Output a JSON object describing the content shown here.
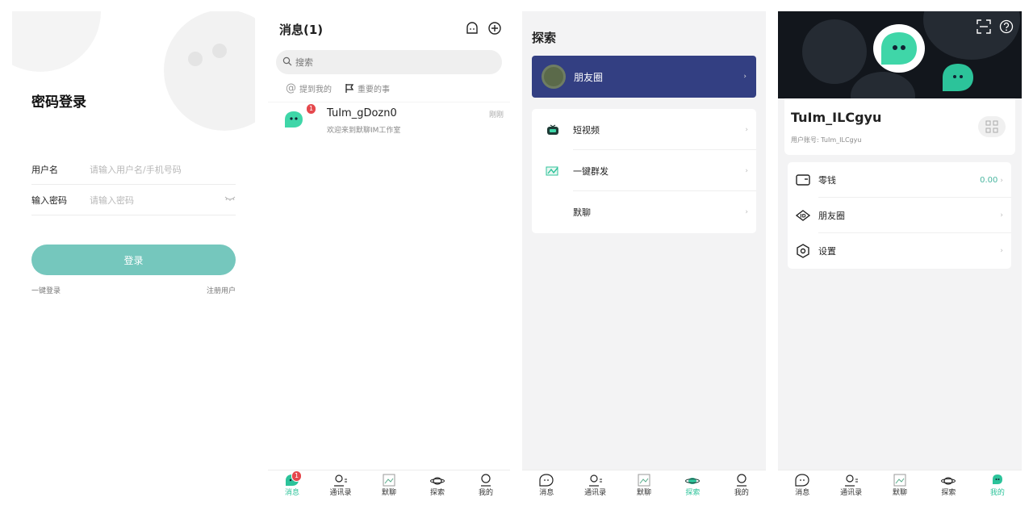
{
  "login": {
    "title": "密码登录",
    "username_label": "用户名",
    "username_placeholder": "请输入用户名/手机号码",
    "password_label": "输入密码",
    "password_placeholder": "请输入密码",
    "login_button": "登录",
    "quick_login": "一键登录",
    "register": "注册用户"
  },
  "messages": {
    "title": "消息(1)",
    "search_placeholder": "搜索",
    "filter_mentions": "提到我的",
    "filter_important": "重要的事",
    "conversations": [
      {
        "name": "TuIm_gDozn0",
        "preview": "欢迎来到默聊IM工作室",
        "time": "刚刚",
        "unread": "1"
      }
    ]
  },
  "explore": {
    "title": "探索",
    "featured": "朋友圈",
    "items": [
      {
        "label": "短视频"
      },
      {
        "label": "一键群发"
      },
      {
        "label": "默聊"
      }
    ]
  },
  "profile": {
    "username": "TuIm_ILCgyu",
    "account": "用户账号: TuIm_ILCgyu",
    "items": [
      {
        "label": "零钱",
        "value": "0.00"
      },
      {
        "label": "朋友圈",
        "value": ""
      },
      {
        "label": "设置",
        "value": ""
      }
    ]
  },
  "tabbar": {
    "messages": "消息",
    "contacts": "通讯录",
    "chat": "默聊",
    "explore": "探索",
    "me": "我的",
    "messages_badge": "1"
  },
  "colors": {
    "accent": "#2cc39a",
    "login_button": "#75c7bd",
    "featured_card": "#333f82",
    "badge": "#e5484d"
  }
}
